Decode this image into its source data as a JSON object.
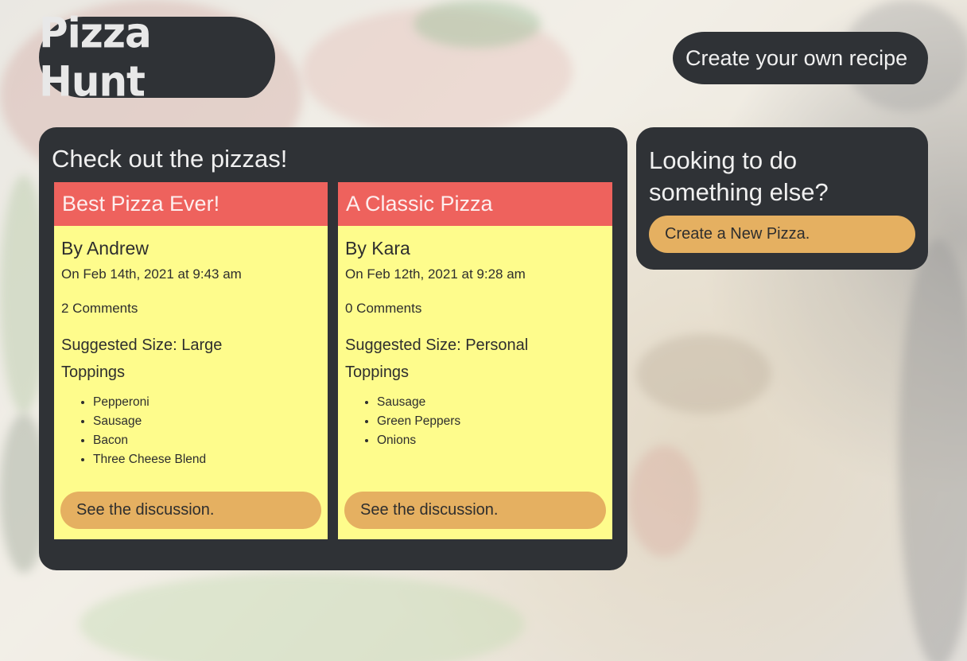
{
  "header": {
    "logo_text": "Pizza Hunt",
    "create_recipe_label": "Create your own recipe"
  },
  "main": {
    "title": "Check out the pizzas!",
    "discussion_label": "See the discussion.",
    "pizzas": [
      {
        "name": "Best Pizza Ever!",
        "author": "By Andrew",
        "date": "On Feb 14th, 2021 at 9:43 am",
        "comments": "2 Comments",
        "size": "Suggested Size: Large",
        "toppings_label": "Toppings",
        "toppings": [
          "Pepperoni",
          "Sausage",
          "Bacon",
          "Three Cheese Blend"
        ],
        "button": "See the discussion."
      },
      {
        "name": "A Classic Pizza",
        "author": "By Kara",
        "date": "On Feb 12th, 2021 at 9:28 am",
        "comments": "0 Comments",
        "size": "Suggested Size: Personal",
        "toppings_label": "Toppings",
        "toppings": [
          "Sausage",
          "Green Peppers",
          "Onions"
        ],
        "button": "See the discussion."
      }
    ]
  },
  "side": {
    "title": "Looking to do something else?",
    "new_pizza_label": "Create a New Pizza."
  },
  "colors": {
    "panel": "#2f3236",
    "card": "#fefc8c",
    "card_header": "#ee625d",
    "button": "#e5b061"
  }
}
